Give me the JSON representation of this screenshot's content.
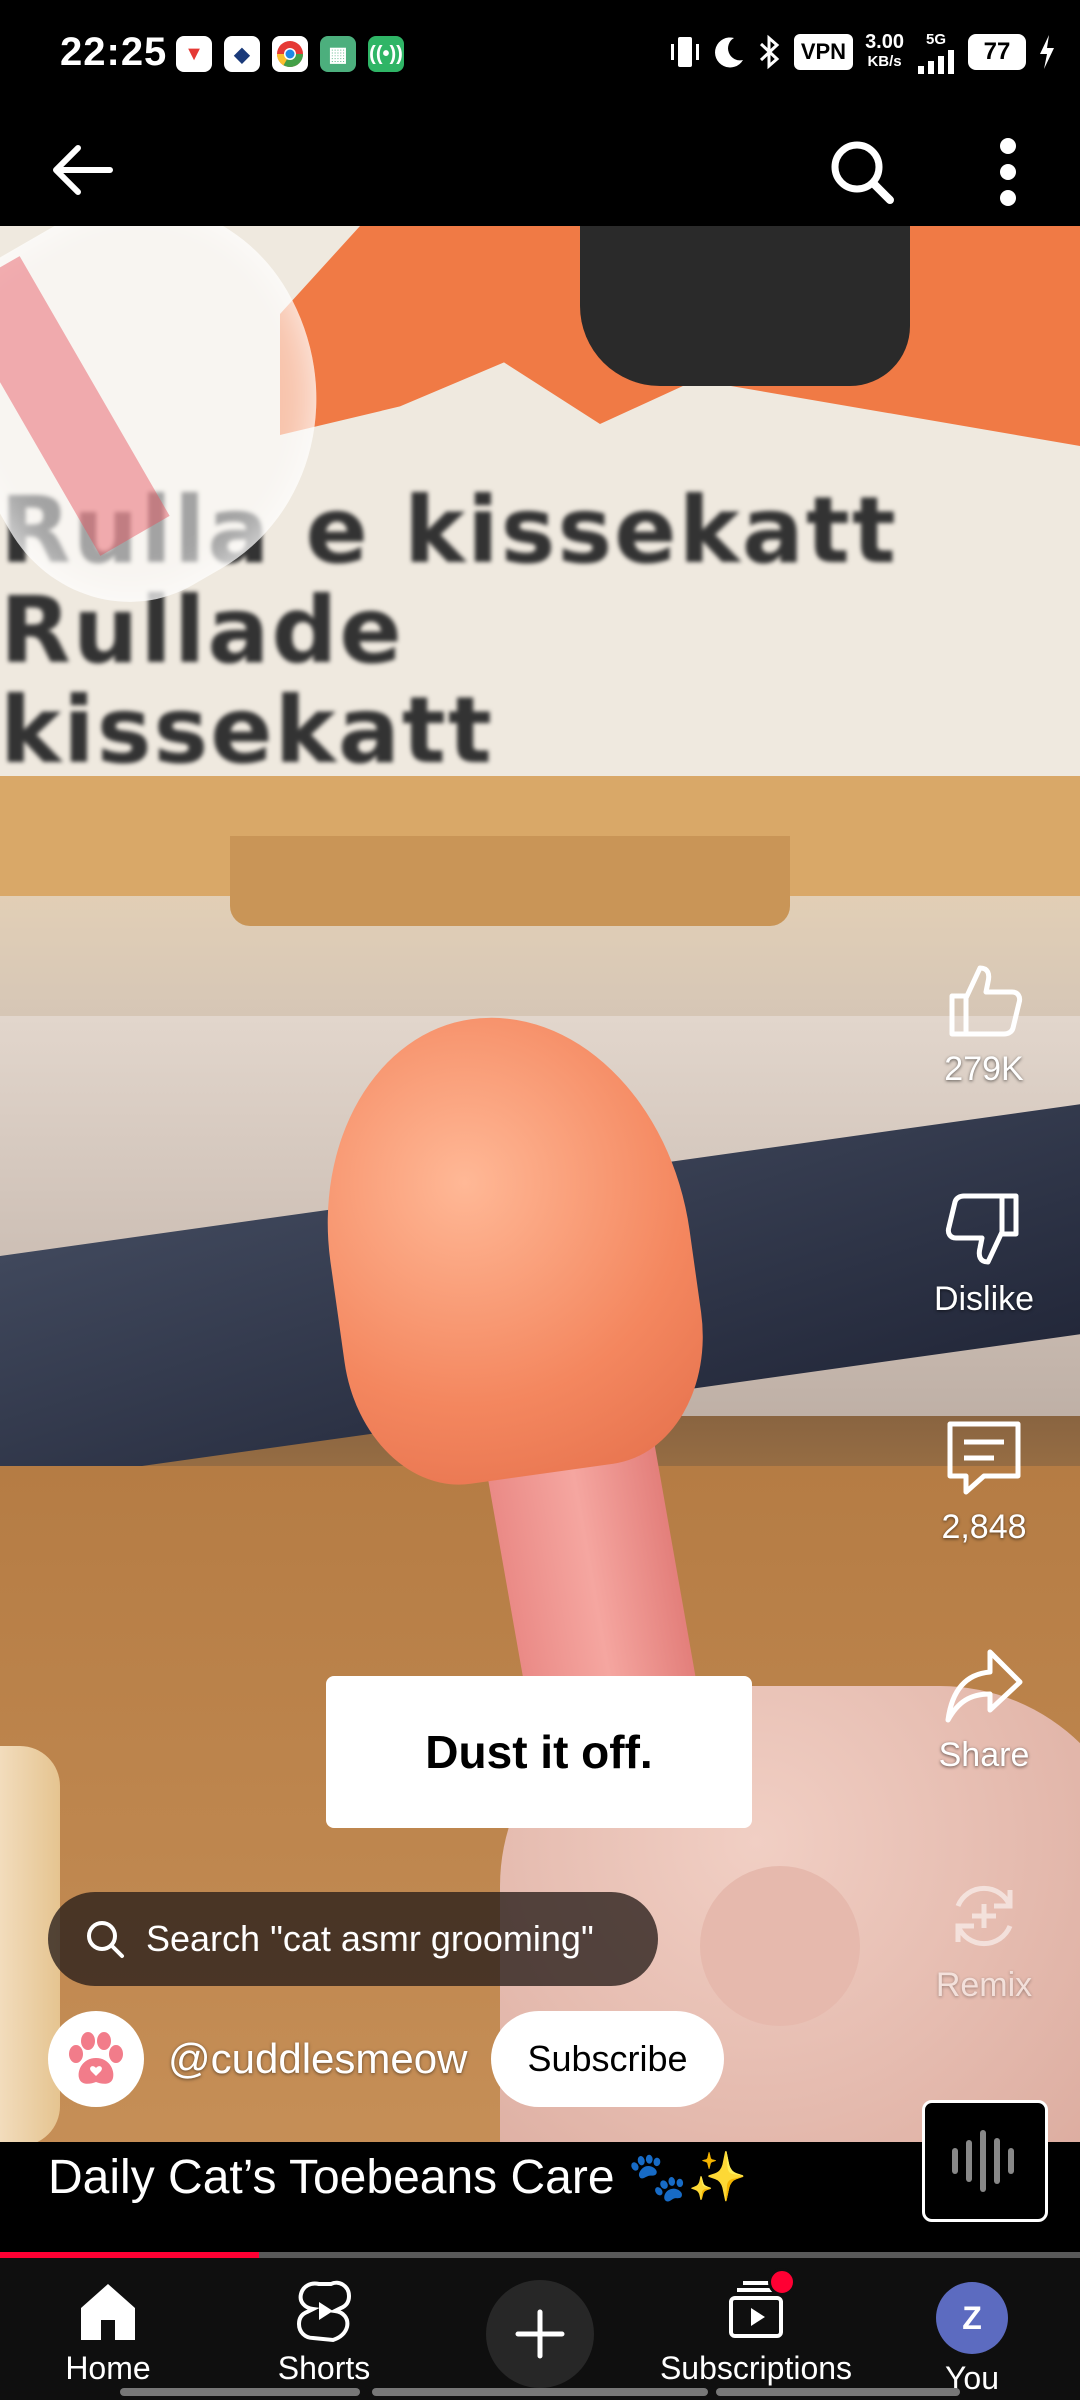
{
  "status_bar": {
    "time": "22:25",
    "vpn": "VPN",
    "speed_value": "3.00",
    "speed_unit": "KB/s",
    "network": "5G",
    "battery": "77"
  },
  "top_bar": {
    "back_icon": "arrow-left-icon",
    "search_icon": "search-icon",
    "more_icon": "more-vert-icon"
  },
  "video": {
    "poster_line1": "Rulla e kissekatt",
    "poster_line2": "Rullade kissekatt",
    "caption": "Dust it off."
  },
  "actions": {
    "like_count": "279K",
    "dislike_label": "Dislike",
    "comment_count": "2,848",
    "share_label": "Share",
    "remix_label": "Remix"
  },
  "search_suggestion": "Search \"cat asmr grooming\"",
  "channel": {
    "handle": "@cuddlesmeow",
    "subscribe_label": "Subscribe"
  },
  "video_title": "Daily Cat’s Toebeans Care 🐾✨",
  "progress": 0.24,
  "colors": {
    "accent": "#ff0033",
    "avatar_bg": "#5c6bc0"
  },
  "nav": {
    "home": "Home",
    "shorts": "Shorts",
    "subscriptions": "Subscriptions",
    "you": "You",
    "you_initial": "Z"
  }
}
